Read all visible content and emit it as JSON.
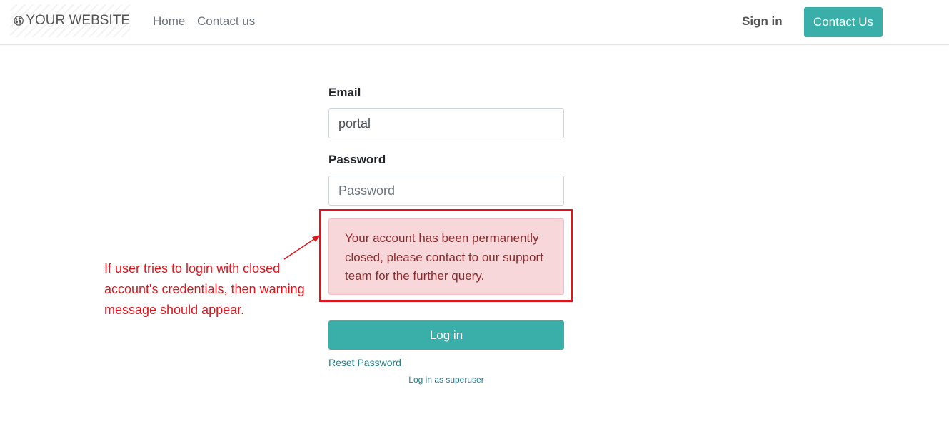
{
  "navbar": {
    "logo_text": "YOUR WEBSITE",
    "logo_icon": "globe-icon",
    "links": [
      {
        "label": "Home"
      },
      {
        "label": "Contact us"
      }
    ],
    "sign_in_label": "Sign in",
    "contact_button_label": "Contact Us"
  },
  "form": {
    "email_label": "Email",
    "email_value": "portal",
    "password_label": "Password",
    "password_placeholder": "Password",
    "password_value": "",
    "alert_message": "Your account has been permanently closed, please contact to our support team for the further query.",
    "login_button_label": "Log in",
    "reset_password_label": "Reset Password",
    "superuser_label": "Log in as superuser"
  },
  "annotation": {
    "text": "If user tries to login with closed account's credentials, then warning message should appear."
  },
  "colors": {
    "accent": "#3aaea9",
    "alert_background": "#f8d7da",
    "alert_text": "#8b2c2f",
    "annotation_red": "#e3131b",
    "link": "#2a7b88"
  }
}
